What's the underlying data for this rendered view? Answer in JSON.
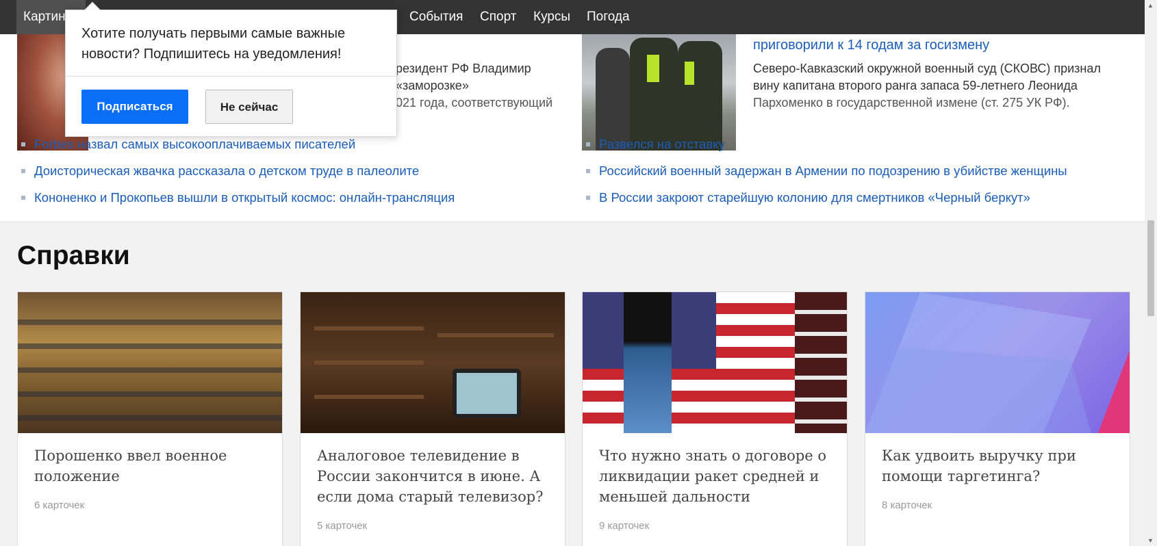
{
  "nav": {
    "items": [
      "Картинки",
      "События",
      "Спорт",
      "Курсы",
      "Погода"
    ]
  },
  "news": {
    "left_lead": {
      "text_line1": "резидент РФ Владимир",
      "text_line2": "«заморозке»",
      "text_line3": "021 года, соответствующий"
    },
    "right_lead": {
      "title": "приговорили к 14 годам за госизмену",
      "text_line1": "Северо-Кавказский окружной военный суд (СКОВС) признал",
      "text_line2": "вину капитана второго ранга запаса 59-летнего Леонида",
      "text_line3": "Пархоменко в государственной измене (ст. 275 УК РФ)."
    },
    "left_links": [
      "Forbes назвал самых высокооплачиваемых писателей",
      "Доисторическая жвачка рассказала о детском труде в палеолите",
      "Кононенко и Прокопьев вышли в открытый космос: онлайн-трансляция"
    ],
    "right_links": [
      "Развелся на отставку",
      "Российский военный задержан в Армении по подозрению в убийстве женщины",
      "В России закроют старейшую колонию для смертников «Черный беркут»"
    ]
  },
  "references": {
    "title": "Справки",
    "cards": [
      {
        "title": "Порошенко ввел военное положение",
        "count": "6 карточек"
      },
      {
        "title": "Аналоговое телевидение в России закончится в июне. А если дома старый телевизор?",
        "count": "5 карточек"
      },
      {
        "title": "Что нужно знать о договоре о ликвидации ракет средней и меньшей дальности",
        "count": "9 карточек"
      },
      {
        "title": "Как удвоить выручку при помощи таргетинга?",
        "count": "8 карточек"
      }
    ]
  },
  "popup": {
    "message": "Хотите получать первыми самые важные новости? Подпишитесь на уведомления!",
    "subscribe_label": "Подписаться",
    "later_label": "Не сейчас"
  },
  "colors": {
    "nav_bg": "#333333",
    "link": "#1a5db8",
    "primary_button": "#0b6ef7"
  }
}
